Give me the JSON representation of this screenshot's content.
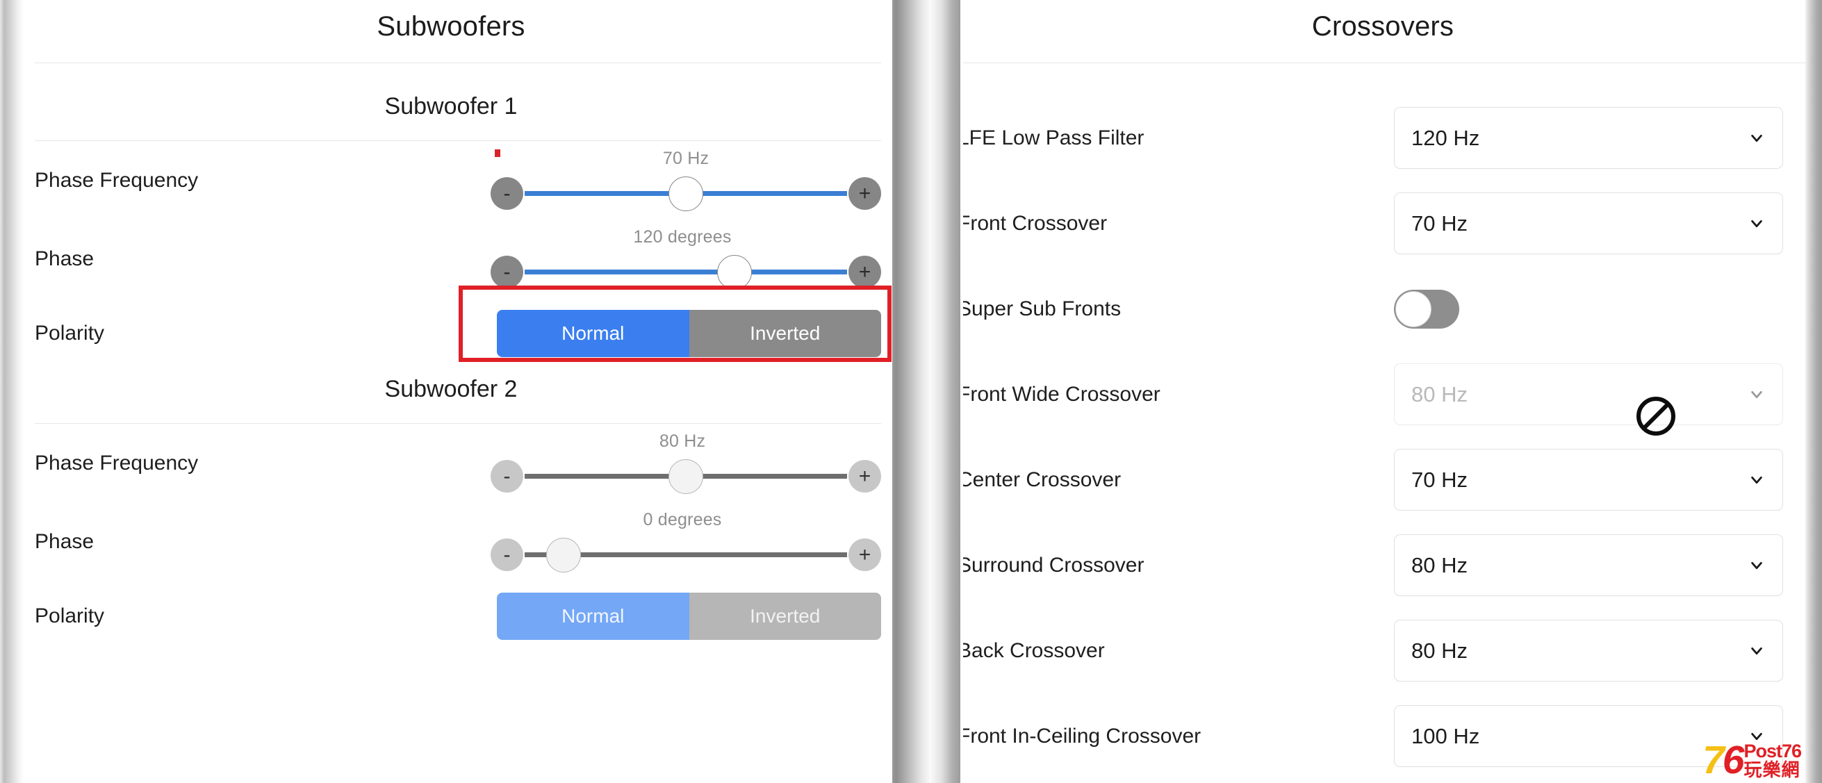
{
  "left_panel": {
    "title": "Subwoofers",
    "sections": [
      {
        "name": "Subwoofer 1",
        "enabled": true,
        "phase_frequency": {
          "label": "Phase Frequency",
          "value": "70 Hz",
          "minus": "-",
          "plus": "+",
          "knob_percent": 50
        },
        "phase": {
          "label": "Phase",
          "value": "120 degrees",
          "minus": "-",
          "plus": "+",
          "knob_percent": 65
        },
        "polarity": {
          "label": "Polarity",
          "selected": "Normal",
          "options": [
            "Normal",
            "Inverted"
          ]
        }
      },
      {
        "name": "Subwoofer 2",
        "enabled": false,
        "phase_frequency": {
          "label": "Phase Frequency",
          "value": "80 Hz",
          "minus": "-",
          "plus": "+",
          "knob_percent": 50
        },
        "phase": {
          "label": "Phase",
          "value": "0 degrees",
          "minus": "-",
          "plus": "+",
          "knob_percent": 12
        },
        "polarity": {
          "label": "Polarity",
          "selected": "Normal",
          "options": [
            "Normal",
            "Inverted"
          ]
        }
      }
    ]
  },
  "right_panel": {
    "title": "Crossovers",
    "rows": [
      {
        "label": "LFE Low Pass Filter",
        "type": "select",
        "value": "120 Hz",
        "disabled": false
      },
      {
        "label": "Front Crossover",
        "type": "select",
        "value": "70 Hz",
        "disabled": false
      },
      {
        "label": "Super Sub Fronts",
        "type": "toggle",
        "value": "off",
        "disabled": false
      },
      {
        "label": "Front Wide Crossover",
        "type": "select",
        "value": "80 Hz",
        "disabled": true
      },
      {
        "label": "Center Crossover",
        "type": "select",
        "value": "70 Hz",
        "disabled": false
      },
      {
        "label": "Surround Crossover",
        "type": "select",
        "value": "80 Hz",
        "disabled": false
      },
      {
        "label": "Back Crossover",
        "type": "select",
        "value": "80 Hz",
        "disabled": false
      },
      {
        "label": "Front In-Ceiling Crossover",
        "type": "select",
        "value": "100 Hz",
        "disabled": false
      }
    ]
  },
  "annotations": {
    "highlight_target": "Subwoofer 1 Phase slider",
    "cursor_icon": "not-allowed-cursor",
    "red_marker": "red-dot-marker"
  },
  "watermark": {
    "logo_7": "7",
    "logo_6": "6",
    "brand": "Post76",
    "brand_cn": "玩樂網"
  },
  "colors": {
    "accent_blue": "#3b7ef0",
    "track_blue": "#3b7fd4",
    "highlight_red": "#e02026",
    "gray_button": "#868686",
    "muted_text": "#8e8e8e"
  }
}
